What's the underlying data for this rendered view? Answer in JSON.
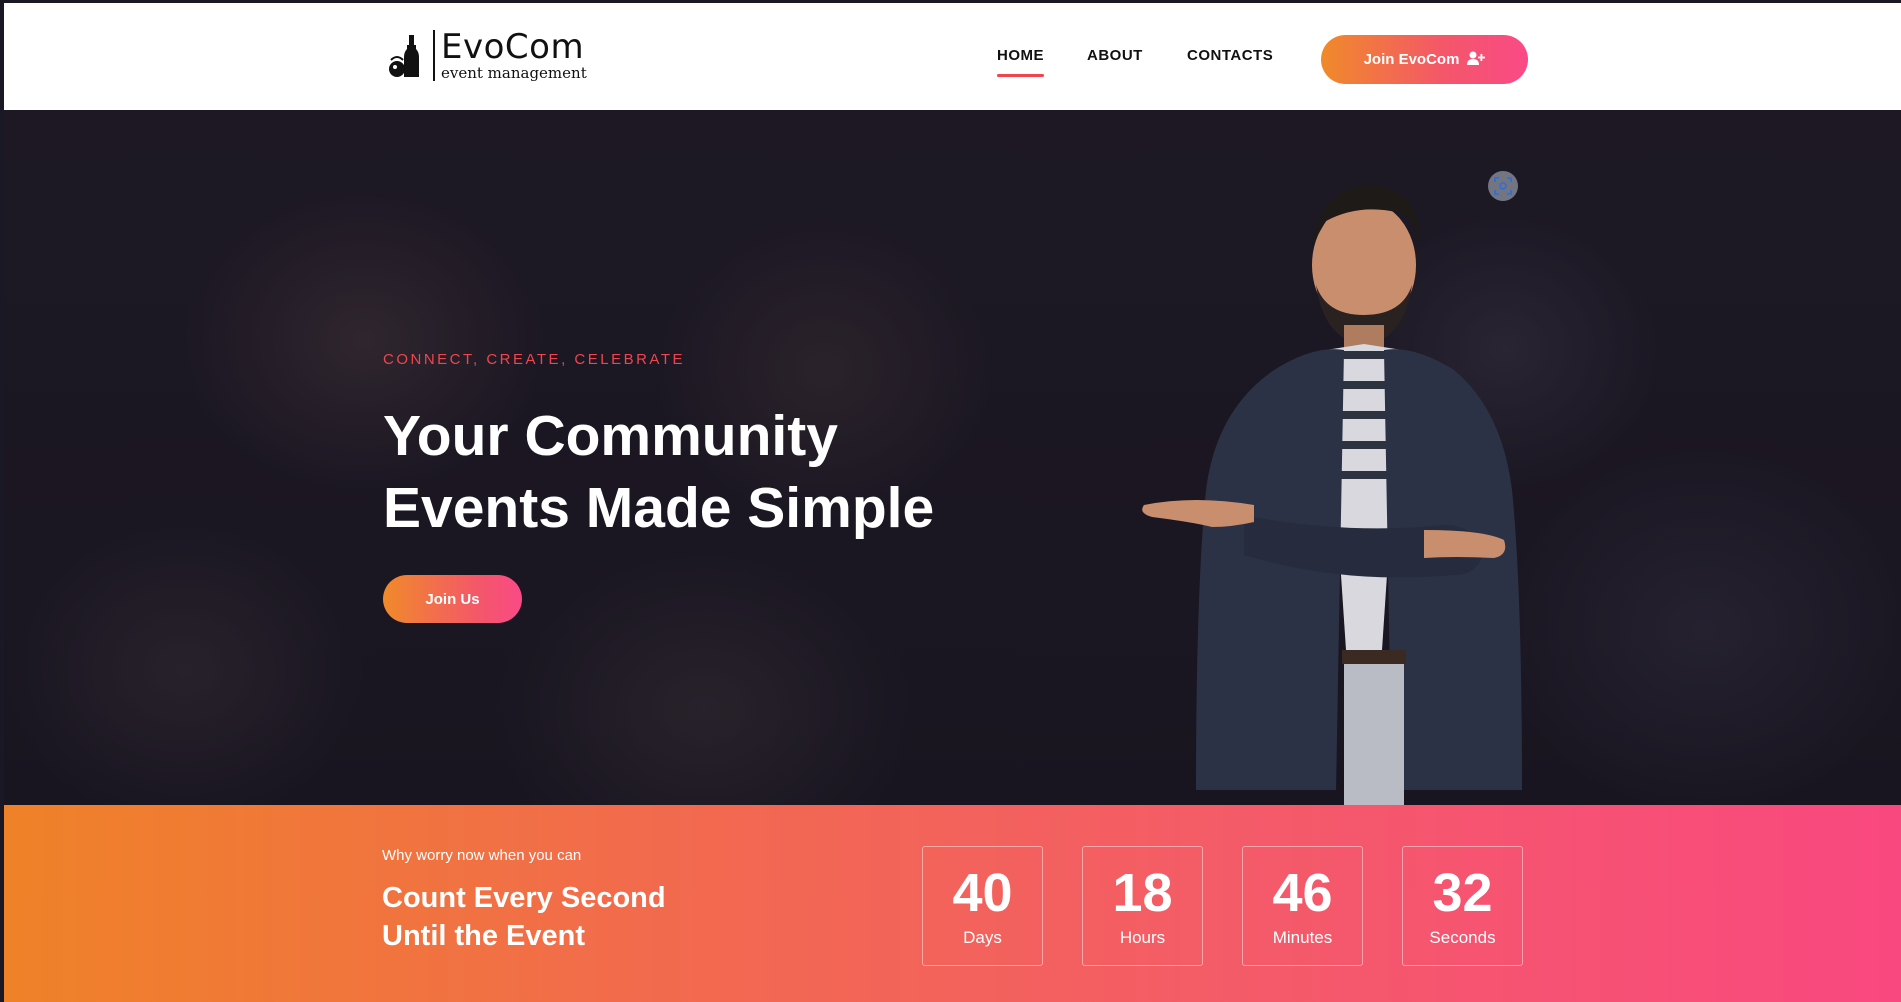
{
  "brand": {
    "name": "EvoCom",
    "tagline": "event management"
  },
  "nav": {
    "items": [
      {
        "label": "HOME",
        "active": true
      },
      {
        "label": "ABOUT",
        "active": false
      },
      {
        "label": "CONTACTS",
        "active": false
      }
    ],
    "cta_label": "Join EvoCom",
    "cta_icon": "user-plus-icon"
  },
  "hero": {
    "eyebrow": "CONNECT, CREATE, CELEBRATE",
    "headline_line1": "Your Community",
    "headline_line2": "Events Made Simple",
    "button_label": "Join Us"
  },
  "countdown": {
    "kicker": "Why worry now when you can",
    "title_line1": "Count Every Second",
    "title_line2": "Until the Event",
    "units": [
      {
        "value": "40",
        "label": "Days"
      },
      {
        "value": "18",
        "label": "Hours"
      },
      {
        "value": "46",
        "label": "Minutes"
      },
      {
        "value": "32",
        "label": "Seconds"
      }
    ]
  },
  "colors": {
    "accent_red": "#f0454d",
    "gradient_start": "#ef8228",
    "gradient_end": "#f9487f",
    "header_bg": "#ffffff",
    "hero_bg": "#1c1823"
  }
}
